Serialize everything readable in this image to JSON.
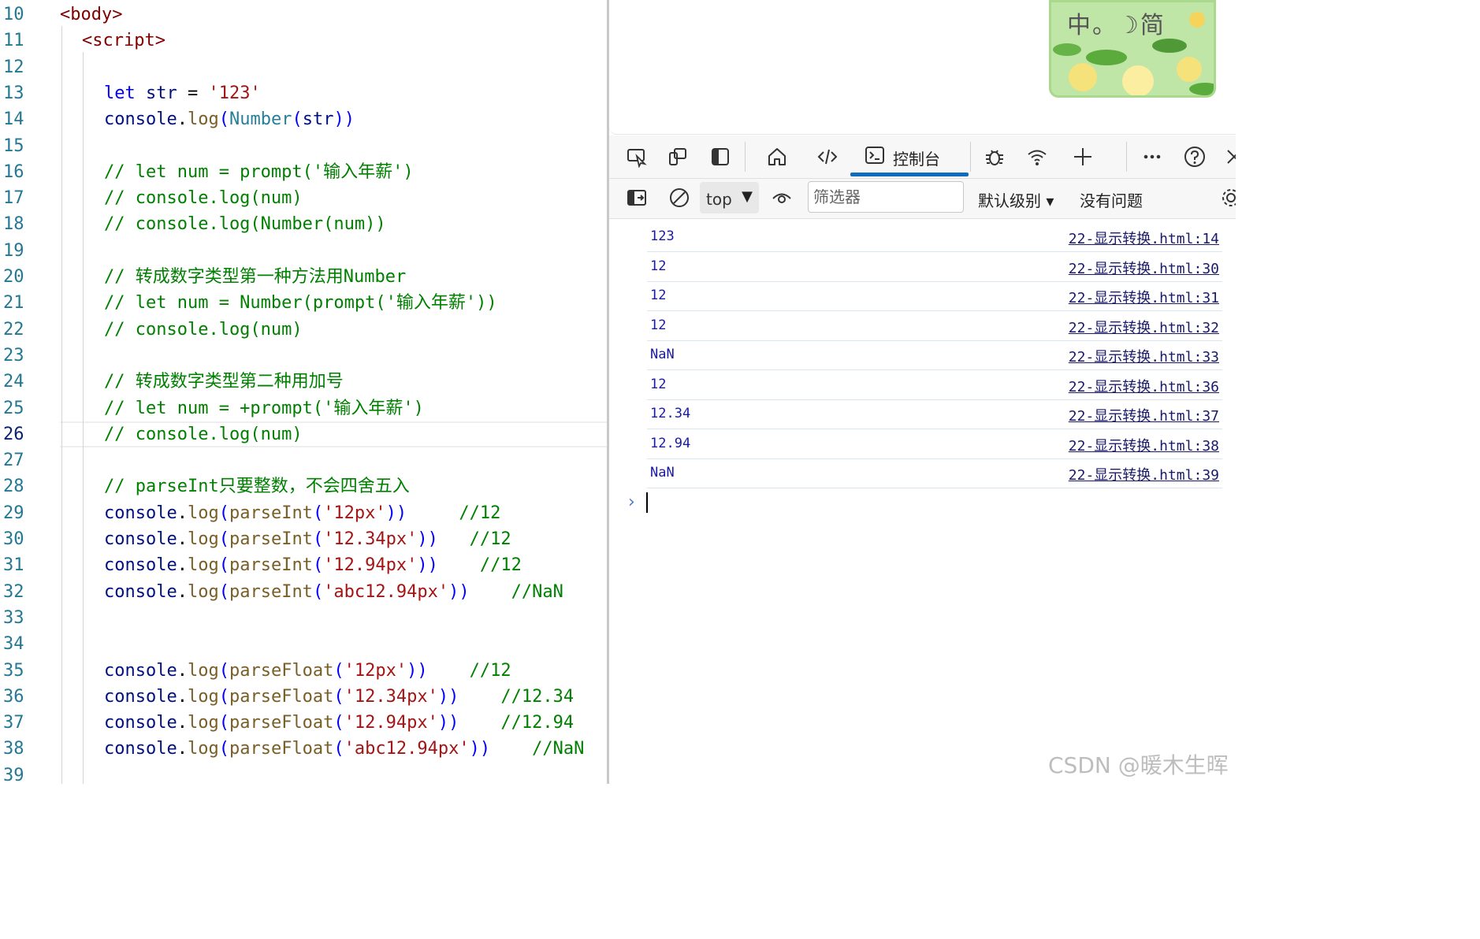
{
  "editor": {
    "lines": [
      {
        "n": "10",
        "indent": 0,
        "tokens": [
          {
            "t": "<body>",
            "c": "t-tag"
          }
        ]
      },
      {
        "n": "11",
        "indent": 1,
        "tokens": [
          {
            "t": "<script>",
            "c": "t-tag"
          }
        ]
      },
      {
        "n": "12",
        "indent": 2,
        "tokens": []
      },
      {
        "n": "13",
        "indent": 2,
        "tokens": [
          {
            "t": "let",
            "c": "t-kw"
          },
          {
            "t": " ",
            "c": "t-op"
          },
          {
            "t": "str",
            "c": "t-var"
          },
          {
            "t": " = ",
            "c": "t-op"
          },
          {
            "t": "'123'",
            "c": "t-str"
          }
        ]
      },
      {
        "n": "14",
        "indent": 2,
        "tokens": [
          {
            "t": "console",
            "c": "t-var"
          },
          {
            "t": ".",
            "c": "t-op"
          },
          {
            "t": "log",
            "c": "t-fn"
          },
          {
            "t": "(",
            "c": "t-kw"
          },
          {
            "t": "Number",
            "c": "t-type"
          },
          {
            "t": "(",
            "c": "t-kw"
          },
          {
            "t": "str",
            "c": "t-var"
          },
          {
            "t": "))",
            "c": "t-kw"
          }
        ]
      },
      {
        "n": "15",
        "indent": 2,
        "tokens": []
      },
      {
        "n": "16",
        "indent": 2,
        "tokens": [
          {
            "t": "// let num = prompt('输入年薪')",
            "c": "t-com"
          }
        ]
      },
      {
        "n": "17",
        "indent": 2,
        "tokens": [
          {
            "t": "// console.log(num)",
            "c": "t-com"
          }
        ]
      },
      {
        "n": "18",
        "indent": 2,
        "tokens": [
          {
            "t": "// console.log(Number(num))",
            "c": "t-com"
          }
        ]
      },
      {
        "n": "19",
        "indent": 2,
        "tokens": []
      },
      {
        "n": "20",
        "indent": 2,
        "tokens": [
          {
            "t": "// 转成数字类型第一种方法用Number",
            "c": "t-com"
          }
        ]
      },
      {
        "n": "21",
        "indent": 2,
        "tokens": [
          {
            "t": "// let num = Number(prompt('输入年薪'))",
            "c": "t-com"
          }
        ]
      },
      {
        "n": "22",
        "indent": 2,
        "tokens": [
          {
            "t": "// console.log(num)",
            "c": "t-com"
          }
        ]
      },
      {
        "n": "23",
        "indent": 2,
        "tokens": []
      },
      {
        "n": "24",
        "indent": 2,
        "tokens": [
          {
            "t": "// 转成数字类型第二种用加号",
            "c": "t-com"
          }
        ]
      },
      {
        "n": "25",
        "indent": 2,
        "tokens": [
          {
            "t": "// let num = +prompt('输入年薪')",
            "c": "t-com"
          }
        ]
      },
      {
        "n": "26",
        "indent": 2,
        "active": true,
        "tokens": [
          {
            "t": "// console.log(num)",
            "c": "t-com"
          }
        ]
      },
      {
        "n": "27",
        "indent": 2,
        "tokens": []
      },
      {
        "n": "28",
        "indent": 2,
        "tokens": [
          {
            "t": "// parseInt只要整数，不会四舍五入",
            "c": "t-com"
          }
        ]
      },
      {
        "n": "29",
        "indent": 2,
        "tokens": [
          {
            "t": "console",
            "c": "t-var"
          },
          {
            "t": ".",
            "c": "t-op"
          },
          {
            "t": "log",
            "c": "t-fn"
          },
          {
            "t": "(",
            "c": "t-kw"
          },
          {
            "t": "parseInt",
            "c": "t-fn"
          },
          {
            "t": "(",
            "c": "t-kw"
          },
          {
            "t": "'12px'",
            "c": "t-str"
          },
          {
            "t": "))",
            "c": "t-kw"
          },
          {
            "t": "     //12",
            "c": "t-com"
          }
        ]
      },
      {
        "n": "30",
        "indent": 2,
        "tokens": [
          {
            "t": "console",
            "c": "t-var"
          },
          {
            "t": ".",
            "c": "t-op"
          },
          {
            "t": "log",
            "c": "t-fn"
          },
          {
            "t": "(",
            "c": "t-kw"
          },
          {
            "t": "parseInt",
            "c": "t-fn"
          },
          {
            "t": "(",
            "c": "t-kw"
          },
          {
            "t": "'12.34px'",
            "c": "t-str"
          },
          {
            "t": "))",
            "c": "t-kw"
          },
          {
            "t": "   //12",
            "c": "t-com"
          }
        ]
      },
      {
        "n": "31",
        "indent": 2,
        "tokens": [
          {
            "t": "console",
            "c": "t-var"
          },
          {
            "t": ".",
            "c": "t-op"
          },
          {
            "t": "log",
            "c": "t-fn"
          },
          {
            "t": "(",
            "c": "t-kw"
          },
          {
            "t": "parseInt",
            "c": "t-fn"
          },
          {
            "t": "(",
            "c": "t-kw"
          },
          {
            "t": "'12.94px'",
            "c": "t-str"
          },
          {
            "t": "))",
            "c": "t-kw"
          },
          {
            "t": "    //12",
            "c": "t-com"
          }
        ]
      },
      {
        "n": "32",
        "indent": 2,
        "tokens": [
          {
            "t": "console",
            "c": "t-var"
          },
          {
            "t": ".",
            "c": "t-op"
          },
          {
            "t": "log",
            "c": "t-fn"
          },
          {
            "t": "(",
            "c": "t-kw"
          },
          {
            "t": "parseInt",
            "c": "t-fn"
          },
          {
            "t": "(",
            "c": "t-kw"
          },
          {
            "t": "'abc12.94px'",
            "c": "t-str"
          },
          {
            "t": "))",
            "c": "t-kw"
          },
          {
            "t": "    //NaN",
            "c": "t-com"
          }
        ]
      },
      {
        "n": "33",
        "indent": 2,
        "tokens": []
      },
      {
        "n": "34",
        "indent": 2,
        "tokens": []
      },
      {
        "n": "35",
        "indent": 2,
        "tokens": [
          {
            "t": "console",
            "c": "t-var"
          },
          {
            "t": ".",
            "c": "t-op"
          },
          {
            "t": "log",
            "c": "t-fn"
          },
          {
            "t": "(",
            "c": "t-kw"
          },
          {
            "t": "parseFloat",
            "c": "t-fn"
          },
          {
            "t": "(",
            "c": "t-kw"
          },
          {
            "t": "'12px'",
            "c": "t-str"
          },
          {
            "t": "))",
            "c": "t-kw"
          },
          {
            "t": "    //12",
            "c": "t-com"
          }
        ]
      },
      {
        "n": "36",
        "indent": 2,
        "tokens": [
          {
            "t": "console",
            "c": "t-var"
          },
          {
            "t": ".",
            "c": "t-op"
          },
          {
            "t": "log",
            "c": "t-fn"
          },
          {
            "t": "(",
            "c": "t-kw"
          },
          {
            "t": "parseFloat",
            "c": "t-fn"
          },
          {
            "t": "(",
            "c": "t-kw"
          },
          {
            "t": "'12.34px'",
            "c": "t-str"
          },
          {
            "t": "))",
            "c": "t-kw"
          },
          {
            "t": "    //12.34",
            "c": "t-com"
          }
        ]
      },
      {
        "n": "37",
        "indent": 2,
        "tokens": [
          {
            "t": "console",
            "c": "t-var"
          },
          {
            "t": ".",
            "c": "t-op"
          },
          {
            "t": "log",
            "c": "t-fn"
          },
          {
            "t": "(",
            "c": "t-kw"
          },
          {
            "t": "parseFloat",
            "c": "t-fn"
          },
          {
            "t": "(",
            "c": "t-kw"
          },
          {
            "t": "'12.94px'",
            "c": "t-str"
          },
          {
            "t": "))",
            "c": "t-kw"
          },
          {
            "t": "    //12.94",
            "c": "t-com"
          }
        ]
      },
      {
        "n": "38",
        "indent": 2,
        "tokens": [
          {
            "t": "console",
            "c": "t-var"
          },
          {
            "t": ".",
            "c": "t-op"
          },
          {
            "t": "log",
            "c": "t-fn"
          },
          {
            "t": "(",
            "c": "t-kw"
          },
          {
            "t": "parseFloat",
            "c": "t-fn"
          },
          {
            "t": "(",
            "c": "t-kw"
          },
          {
            "t": "'abc12.94px'",
            "c": "t-str"
          },
          {
            "t": "))",
            "c": "t-kw"
          },
          {
            "t": "    //NaN",
            "c": "t-com"
          }
        ]
      },
      {
        "n": "39",
        "indent": 2,
        "tokens": []
      }
    ]
  },
  "devtools": {
    "ime_widget": {
      "text": "中。☽简"
    },
    "tabs": {
      "console_label": "控制台",
      "icons": [
        "inspect-icon",
        "device-emulation-icon",
        "dock-side-icon",
        "welcome-home-icon",
        "elements-icon",
        "console-icon",
        "debug-icon",
        "network-wifi-icon",
        "add-tool-icon",
        "more-icon",
        "help-icon",
        "close-icon"
      ]
    },
    "toolbar": {
      "context": "top",
      "context_arrow": "▼",
      "filter_placeholder": "筛选器",
      "level_label": "默认级别 ▾",
      "issues_label": "没有问题"
    },
    "console": {
      "entries": [
        {
          "msg": "123",
          "src": "22-显示转换.html:14"
        },
        {
          "msg": "12",
          "src": "22-显示转换.html:30"
        },
        {
          "msg": "12",
          "src": "22-显示转换.html:31"
        },
        {
          "msg": "12",
          "src": "22-显示转换.html:32"
        },
        {
          "msg": "NaN",
          "src": "22-显示转换.html:33"
        },
        {
          "msg": "12",
          "src": "22-显示转换.html:36"
        },
        {
          "msg": "12.34",
          "src": "22-显示转换.html:37"
        },
        {
          "msg": "12.94",
          "src": "22-显示转换.html:38"
        },
        {
          "msg": "NaN",
          "src": "22-显示转换.html:39"
        }
      ],
      "prompt_symbol": "›"
    }
  },
  "watermark": "CSDN @暖木生晖",
  "colors": {
    "accent": "#0f6cbd",
    "keyword": "#0000ff",
    "string": "#a31515",
    "comment": "#008000",
    "tag": "#800000"
  }
}
